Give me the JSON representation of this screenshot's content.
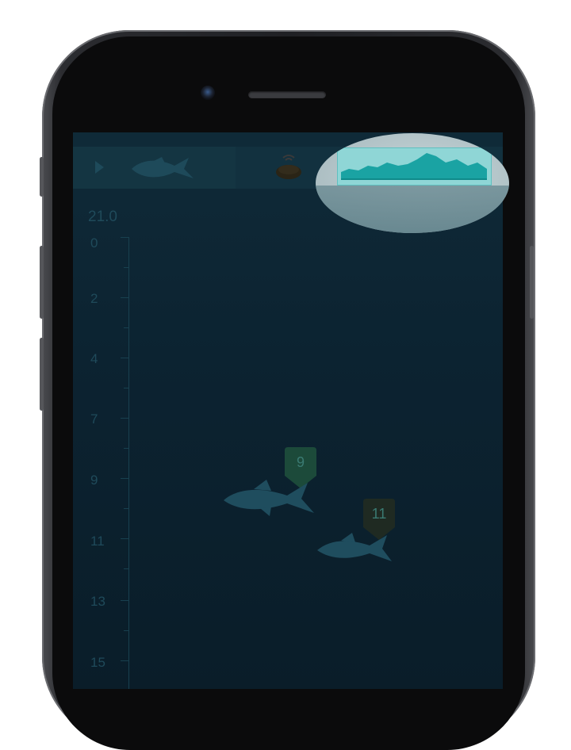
{
  "toolbar": {
    "play_icon": "play-icon",
    "fish_icon": "fish-icon",
    "sonar_icon": "sonar-device-icon",
    "depth_graph_icon": "depth-profile-graph-icon"
  },
  "depth_readout": "21.0",
  "depth_scale": [
    "0",
    "2",
    "4",
    "7",
    "9",
    "11",
    "13",
    "15"
  ],
  "fish_markers": [
    {
      "depth_label": "9",
      "color": "#1c4a3a"
    },
    {
      "depth_label": "11",
      "color": "#1f2a22"
    }
  ],
  "colors": {
    "screen_bg": "#0c2331",
    "accent_teal": "#1fb3b3",
    "highlight_bg": "#b3c4c8"
  }
}
